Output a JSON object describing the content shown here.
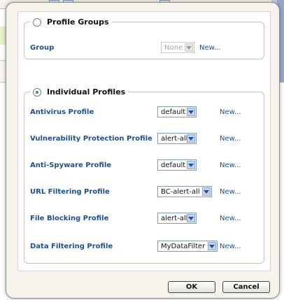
{
  "profile_groups": {
    "legend": "Profile Groups",
    "selected": false,
    "group_label": "Group",
    "group_value": "None",
    "new_link": "New..."
  },
  "individual_profiles": {
    "legend": "Individual Profiles",
    "selected": true,
    "rows": [
      {
        "label": "Antivirus Profile",
        "value": "default",
        "new_link": "New..."
      },
      {
        "label": "Vulnerability Protection Profile",
        "value": "alert-all",
        "new_link": "New..."
      },
      {
        "label": "Anti-Spyware Profile",
        "value": "default",
        "new_link": "New..."
      },
      {
        "label": "URL Filtering Profile",
        "value": "BC-alert-all",
        "new_link": "New..."
      },
      {
        "label": "File Blocking Profile",
        "value": "alert-all",
        "new_link": "New..."
      },
      {
        "label": "Data Filtering Profile",
        "value": "MyDataFilter",
        "new_link": "New..."
      }
    ]
  },
  "buttons": {
    "ok": "OK",
    "cancel": "Cancel"
  },
  "colors": {
    "label": "#1f4f8f",
    "radio_selected": "#2f9a3a",
    "dialog_bg": "#f5f3ec"
  }
}
